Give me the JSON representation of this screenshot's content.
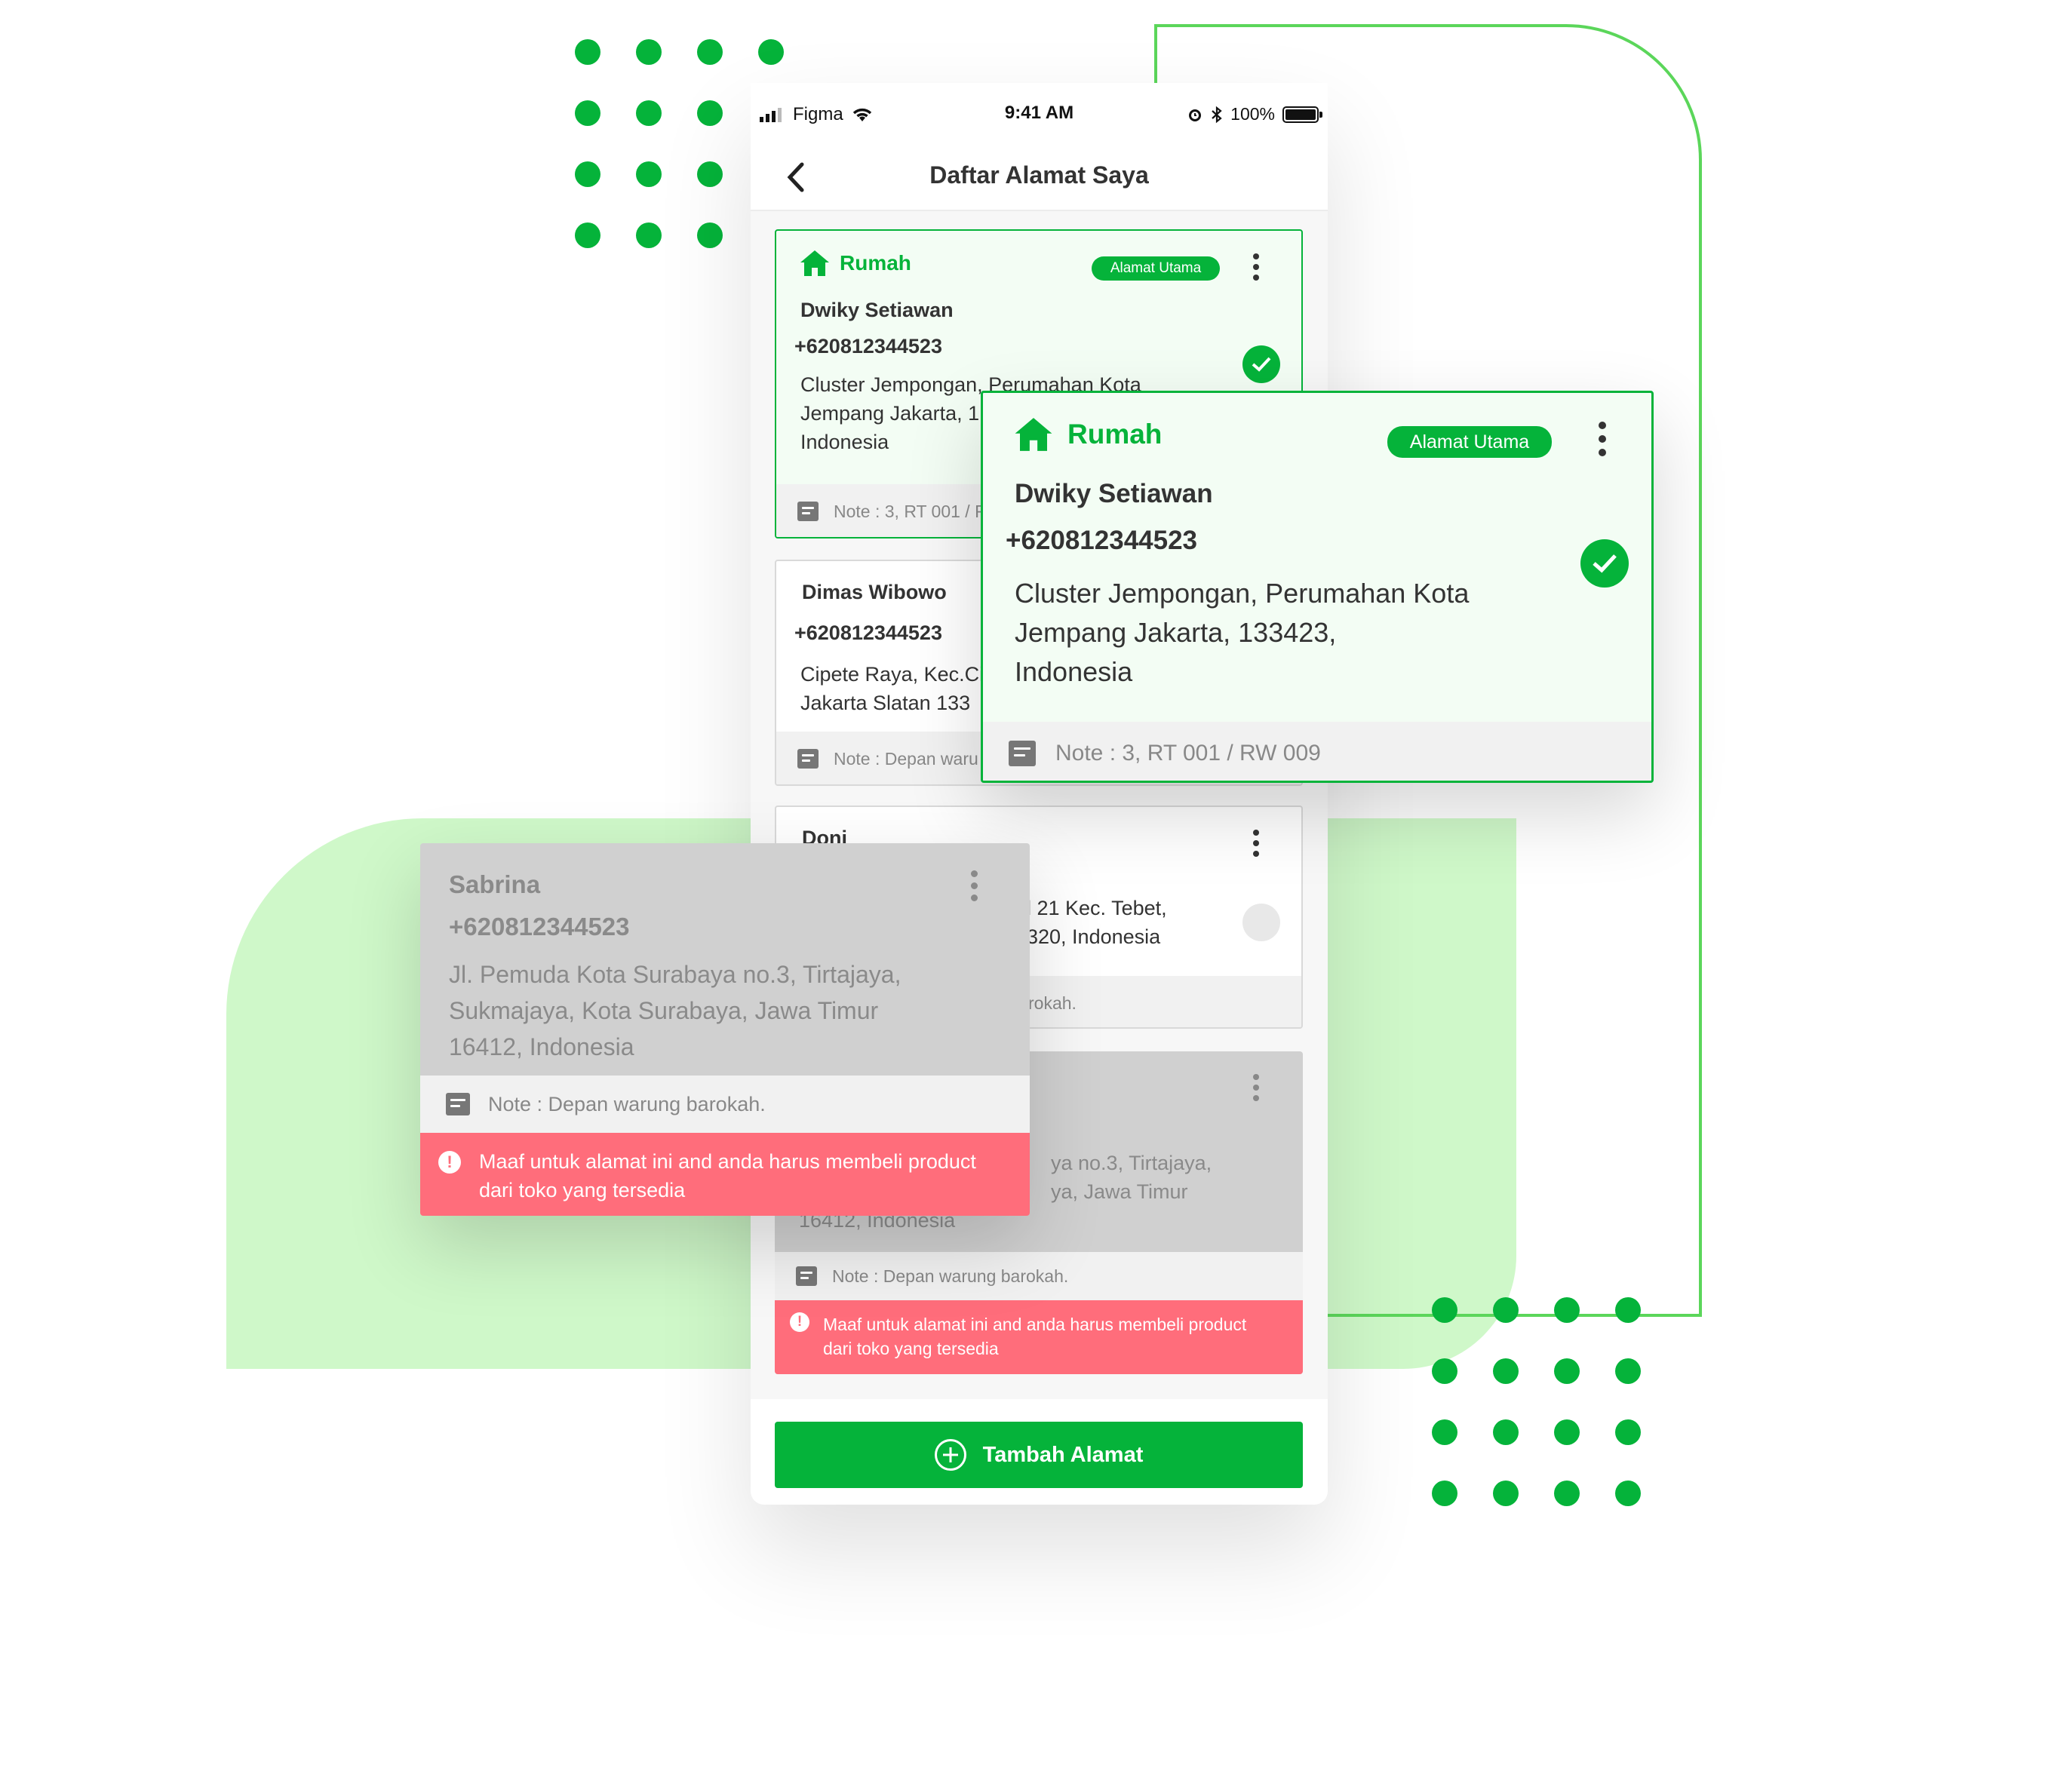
{
  "colors": {
    "brand": "#05b33a",
    "error": "#ff6d7b",
    "blob": "#cff8c9"
  },
  "statusbar": {
    "carrier": "Figma",
    "time": "9:41 AM",
    "battery": "100%"
  },
  "header": {
    "title": "Daftar Alamat Saya"
  },
  "addresses": [
    {
      "label": "Rumah",
      "badge": "Alamat Utama",
      "name": "Dwiky Setiawan",
      "phone": "+620812344523",
      "address": "Cluster Jempongan, Perumahan Kota Jempang Jakarta, 133423, Indonesia",
      "addr_line1": "Cluster Jempongan, Perumahan Kota",
      "addr_line2": "Jempang Jakarta, 1",
      "addr_line3": "Indonesia",
      "note": "Note : 3, RT 001 / R"
    },
    {
      "name": "Dimas Wibowo",
      "phone": "+620812344523",
      "addr_line1": "Cipete Raya, Kec.Ci",
      "addr_line2": "Jakarta Slatan 133",
      "note": "Note : Depan waru"
    },
    {
      "name": "Doni",
      "addr_line1": "l 21 Kec. Tebet,",
      "addr_line2": "320, Indonesia",
      "note": "rokah."
    },
    {
      "addr_line1": "ya no.3, Tirtajaya,",
      "addr_line2": "ya, Jawa Timur",
      "addr_line3": "16412, Indonesia",
      "note": "Note : Depan warung barokah.",
      "error_line1": "Maaf untuk alamat ini and anda harus membeli product",
      "error_line2": "dari toko yang tersedia"
    }
  ],
  "zoom_primary": {
    "label": "Rumah",
    "badge": "Alamat Utama",
    "name": "Dwiky Setiawan",
    "phone": "+620812344523",
    "addr_line1": "Cluster Jempongan, Perumahan Kota",
    "addr_line2": "Jempang Jakarta, 133423,",
    "addr_line3": "Indonesia",
    "note": "Note : 3, RT 001 / RW 009"
  },
  "zoom_disabled": {
    "name": "Sabrina",
    "phone": "+620812344523",
    "addr_line1": "Jl. Pemuda Kota Surabaya no.3, Tirtajaya,",
    "addr_line2": "Sukmajaya, Kota Surabaya, Jawa Timur",
    "addr_line3": "16412, Indonesia",
    "note": "Note : Depan warung barokah.",
    "error_line1": "Maaf untuk alamat ini and anda harus membeli product",
    "error_line2": "dari toko yang tersedia"
  },
  "footer": {
    "add_button": "Tambah Alamat"
  },
  "icons": [
    "home-icon",
    "kebab-menu-icon",
    "check-circle-icon",
    "note-icon",
    "error-icon",
    "plus-circle-icon",
    "back-arrow-icon",
    "signal-icon",
    "wifi-icon",
    "alarm-icon",
    "bluetooth-icon",
    "battery-icon"
  ]
}
